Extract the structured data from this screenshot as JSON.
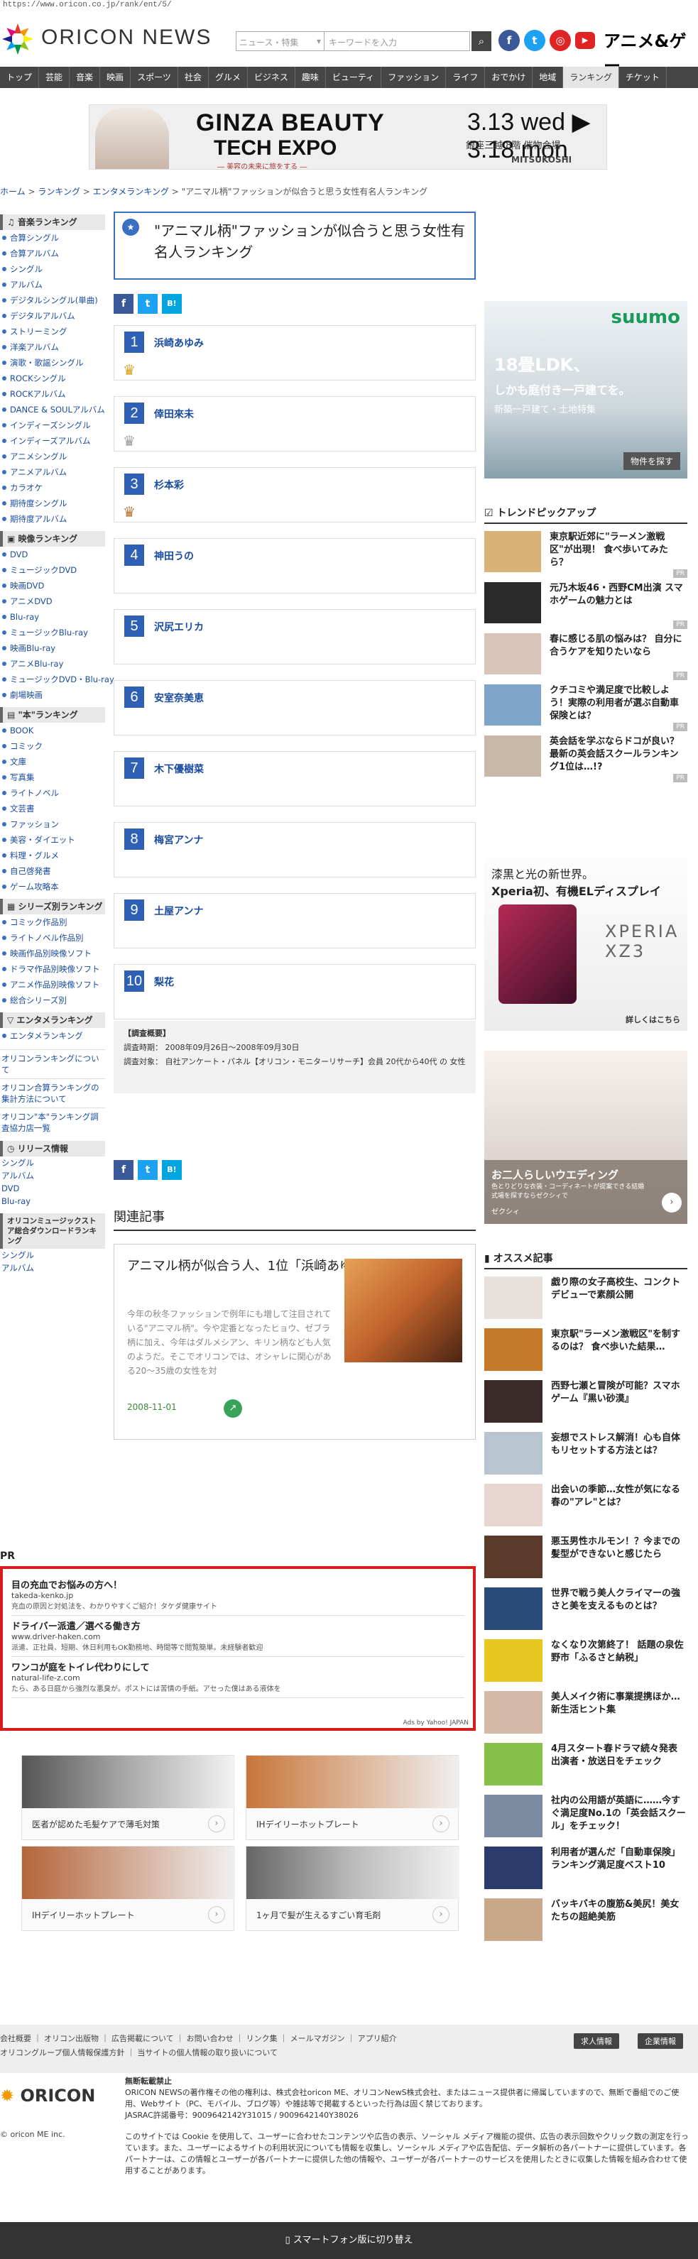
{
  "url": "https://www.oricon.co.jp/rank/ent/5/",
  "header": {
    "logo": "ORICON NEWS",
    "search_select": "ニュース・特集",
    "search_placeholder": "キーワードを入力",
    "anime_logo": "アニメ&ゲー"
  },
  "nav": [
    "トップ",
    "芸能",
    "音楽",
    "映画",
    "スポーツ",
    "社会",
    "グルメ",
    "ビジネス",
    "趣味",
    "ビューティ",
    "ファッション",
    "ライフ",
    "おでかけ",
    "地域",
    "ランキング",
    "チケット"
  ],
  "banner": {
    "line1": "GINZA BEAUTY",
    "line2": "TECH EXPO",
    "sub": "― 美容の未来に旅をする ―",
    "date": "3.13 wed ▶ 3.18 mon",
    "venue": "銀座三越 8階 催物会場",
    "brand": "MITSUKOSHI"
  },
  "breadcrumb": {
    "home": "ホーム",
    "rank": "ランキング",
    "ent": "エンタメランキング",
    "current": "\"アニマル柄\"ファッションが似合うと思う女性有名人ランキング"
  },
  "sidebar": {
    "music_h": "音楽ランキング",
    "music": [
      "合算シングル",
      "合算アルバム",
      "シングル",
      "アルバム",
      "デジタルシングル(単曲)",
      "デジタルアルバム",
      "ストリーミング",
      "洋楽アルバム",
      "演歌・歌謡シングル",
      "ROCKシングル",
      "ROCKアルバム",
      "DANCE & SOULアルバム",
      "インディーズシングル",
      "インディーズアルバム",
      "アニメシングル",
      "アニメアルバム",
      "カラオケ",
      "期待度シングル",
      "期待度アルバム"
    ],
    "video_h": "映像ランキング",
    "video": [
      "DVD",
      "ミュージックDVD",
      "映画DVD",
      "アニメDVD",
      "Blu-ray",
      "ミュージックBlu-ray",
      "映画Blu-ray",
      "アニメBlu-ray",
      "ミュージックDVD・Blu-ray",
      "劇場映画"
    ],
    "book_h": "\"本\"ランキング",
    "book": [
      "BOOK",
      "コミック",
      "文庫",
      "写真集",
      "ライトノベル",
      "文芸書",
      "ファッション",
      "美容・ダイエット",
      "料理・グルメ",
      "自己啓発書",
      "ゲーム攻略本"
    ],
    "series_h": "シリーズ別ランキング",
    "series": [
      "コミック作品別",
      "ライトノベル作品別",
      "映画作品別映像ソフト",
      "ドラマ作品別映像ソフト",
      "アニメ作品別映像ソフト",
      "総合シリーズ別"
    ],
    "ent_h": "エンタメランキング",
    "ent": [
      "エンタメランキング"
    ],
    "links": [
      "オリコンランキングについて",
      "オリコン合算ランキングの集計方法について",
      "オリコン\"本\"ランキング調査協力店一覧"
    ],
    "release_h": "リリース情報",
    "release": [
      "シングル",
      "アルバム",
      "DVD",
      "Blu-ray"
    ],
    "store_h": "オリコンミュージックストア総合ダウンロードランキング",
    "store": [
      "シングル",
      "アルバム"
    ]
  },
  "main": {
    "title": "\"アニマル柄\"ファッションが似合うと思う女性有名人ランキング",
    "ranks": [
      {
        "num": "1",
        "name": "浜崎あゆみ"
      },
      {
        "num": "2",
        "name": "倖田來未"
      },
      {
        "num": "3",
        "name": "杉本彩"
      },
      {
        "num": "4",
        "name": "神田うの"
      },
      {
        "num": "5",
        "name": "沢尻エリカ"
      },
      {
        "num": "6",
        "name": "安室奈美恵"
      },
      {
        "num": "7",
        "name": "木下優樹菜"
      },
      {
        "num": "8",
        "name": "梅宮アンナ"
      },
      {
        "num": "9",
        "name": "土屋アンナ"
      },
      {
        "num": "10",
        "name": "梨花"
      }
    ],
    "survey": {
      "h": "【調査概要】",
      "period": "調査時期： 2008年09月26日～2008年09月30日",
      "target": "調査対象： 自社アンケート・パネル【オリコン・モニターリサーチ】会員 20代から40代 の 女性"
    },
    "related_h": "関連記事",
    "related": {
      "title": "アニマル柄が似合う人、1位「浜崎あゆみ」",
      "body": "今年の秋冬ファッションで例年にも増して注目されている\"アニマル柄\"。今や定番となったヒョウ、ゼブラ柄に加え、今年はダルメシアン、キリン柄なども人気のようだ。そこでオリコンでは、オシャレに関心がある20～35歳の女性を対",
      "date": "2008-11-01"
    }
  },
  "right": {
    "suumo": {
      "brand": "suumo",
      "big": "18畳LDK、",
      "copy": "しかも庭付き一戸建てを。",
      "sub": "新築一戸建て・土地特集",
      "btn": "物件を探す"
    },
    "trend_h": "トレンドピックアップ",
    "trends": [
      "東京駅近郊に\"ラーメン激戦区\"が出現！ 食べ歩いてみたら？",
      "元乃木坂46・西野CM出演 スマホゲームの魅力とは",
      "春に感じる肌の悩みは？ 自分に合うケアを知りたいなら",
      "クチコミや満足度で比較しよう！実際の利用者が選ぶ自動車保険とは？",
      "英会話を学ぶならドコが良い？最新の英会話スクールランキング1位は…!?"
    ],
    "xperia": {
      "h": "漆黒と光の新世界。",
      "sub": "Xperia初、有機ELディスプレイ",
      "model": "XPERIA XZ3",
      "more": "詳しくはこちら"
    },
    "wedding": {
      "title": "お二人らしいウエディング",
      "sub": "色とりどりな衣装・コーディネートが提案できる結婚式場を探すならゼクシィで",
      "brand": "ゼクシィ"
    },
    "reco_h": "オススメ記事",
    "recos": [
      "戯り際の女子高校生、コンクトデビューで素顔公開",
      "東京駅\"ラーメン激戦区\"を制するのは？ 食べ歩いた結果…",
      "西野七瀬と冒険が可能？スマホゲーム『黒い砂漠』",
      "妄想でストレス解消！心も自体もリセットする方法とは？",
      "出会いの季節…女性が気になる春の\"アレ\"とは？",
      "悪玉男性ホルモン！？今までの髪型ができないと感じたら",
      "世界で戦う美人クライマーの強さと美を支えるものとは？",
      "なくなり次第終了！ 話題の泉佐野市「ふるさと納税」",
      "美人メイク術に事業提携ほか…新生活ヒント集",
      "4月スタート春ドラマ続々発表出演者・放送日をチェック",
      "社内の公用語が英語に……今すぐ満足度No.1の「英会話スクール」をチェック！",
      "利用者が選んだ「自動車保険」ランキング満足度ベスト10",
      "バッキバキの腹筋&美尻！美女たちの超絶美筋"
    ],
    "pr": "PR"
  },
  "pr": {
    "label": "PR",
    "ads": [
      {
        "t": "目の充血でお悩みの方へ！",
        "u": "takeda-kenko.jp",
        "d": "充血の原因と対処法を、わかりやすくご紹介！タケダ健康サイト"
      },
      {
        "t": "ドライバー派遣／選べる働き方",
        "u": "www.driver-haken.com",
        "d": "派遣、正社員、短期、休日利用もOK勤務地、時間等で閲覧簡単。未経験者歓迎"
      },
      {
        "t": "ワンコが庭をトイレ代わりにして",
        "u": "natural-life-z.com",
        "d": "たら、ある日庭から強烈な悪臭が。ポストには苦情の手紙。アセった僕はある液体を"
      }
    ],
    "foot": "Ads by Yahoo! JAPAN",
    "cards": [
      "医者が認めた毛髪ケアで薄毛対策",
      "IHデイリーホットプレート",
      "IHデイリーホットプレート",
      "1ヶ月で髪が生えるすごい育毛剤"
    ]
  },
  "footer": {
    "links": "会社概要 ｜ オリコン出版物 ｜ 広告掲載について ｜ お問い合わせ ｜ リンク集 ｜ メールマガジン ｜ アプリ紹介",
    "links2": "オリコングループ個人情報保護方針 ｜ 当サイトの個人情報の取り扱いについて",
    "b1": "求人情報",
    "b2": "企業情報",
    "logo": "ORICON",
    "copy": "© oricon ME inc.",
    "notice_h": "無断転載禁止",
    "notice": "ORICON NEWSの著作権その他の権利は、株式会社oricon ME、オリコンNewS株式会社、またはニュース提供者に帰属していますので、無断で番組でのご使用、Webサイト（PC、モバイル、ブログ等）や雑誌等で掲載するといった行為は固く禁じております。",
    "jasrac": "JASRAC許諾番号：9009642142Y31015 / 9009642140Y38026",
    "cookie": "このサイトでは Cookie を使用して、ユーザーに合わせたコンテンツや広告の表示、ソーシャル メディア機能の提供、広告の表示回数やクリック数の測定を行っています。また、ユーザーによるサイトの利用状況についても情報を収集し、ソーシャル メディアや広告配信、データ解析の各パートナーに提供しています。各パートナーは、この情報とユーザーが各パートナーに提供した他の情報や、ユーザーが各パートナーのサービスを使用したときに収集した情報を組み合わせて使用することがあります。",
    "smart": "スマートフォン版に切り替え"
  },
  "colors": {
    "accent": "#2e61b5",
    "nav": "#454545",
    "pr_border": "#d81c1c"
  }
}
